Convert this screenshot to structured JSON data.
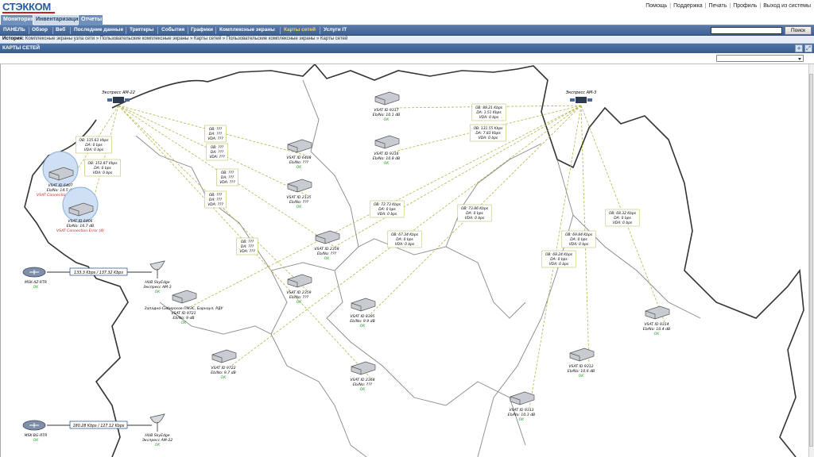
{
  "brand": "СТЭККОМ",
  "top_links": [
    "Помощь",
    "Поддержка",
    "Печать",
    "Профиль",
    "Выход из системы"
  ],
  "main_tabs": [
    "Мониторинг",
    "Инвентаризация",
    "Отчеты"
  ],
  "sub_menu": [
    "ПАНЕЛЬ",
    "Обзор",
    "Веб",
    "Последние данные",
    "Триггеры",
    "События",
    "Графики",
    "Комплексные экраны",
    "Карты сетей",
    "Услуги IT"
  ],
  "search_button": "Поиск",
  "history_label": "История:",
  "history_items": "Комплексные экраны узла сети » Пользовательские комплексные экраны » Карты сетей » Пользовательские комплексные экраны » Карты сетей",
  "page_title": "КАРТЫ СЕТЕЙ",
  "colors": {
    "accent": "#3f6094",
    "ok": "#1a9a1a",
    "error": "#cc2020",
    "link": "#b4b44a"
  },
  "hubs": [
    {
      "id": "hub-am22",
      "label": "Экспресс АМ-22"
    },
    {
      "id": "hub-am3",
      "label": "Экспресс АМ-3"
    }
  ],
  "vsats": [
    {
      "id": "v6407",
      "lines": [
        "VSAT ID 6407",
        "Eb/No: 14.5 dB"
      ],
      "status": "VSAT Connection Error (4)",
      "status_kind": "error"
    },
    {
      "id": "v6406",
      "lines": [
        "VSAT ID 6406",
        "Eb/No: 16.7 dB"
      ],
      "status": "VSAT Connection Error (4)",
      "status_kind": "error"
    },
    {
      "id": "v6408",
      "lines": [
        "VSAT ID 6408",
        "Eb/No: ???"
      ],
      "status": "OK",
      "status_kind": "ok"
    },
    {
      "id": "v9317",
      "lines": [
        "VSAT ID 9317",
        "Eb/No: 10.1 dB"
      ],
      "status": "OK",
      "status_kind": "ok"
    },
    {
      "id": "v9316",
      "lines": [
        "VSAT ID 9316",
        "Eb/No: 10.8 dB"
      ],
      "status": "OK",
      "status_kind": "ok"
    },
    {
      "id": "v2135",
      "lines": [
        "VSAT ID 2135",
        "Eb/No: ???"
      ],
      "status": "OK",
      "status_kind": "ok"
    },
    {
      "id": "v2358",
      "lines": [
        "VSAT ID 2358",
        "Eb/No: ???"
      ],
      "status": "OK",
      "status_kind": "ok"
    },
    {
      "id": "v2359",
      "lines": [
        "VSAT ID 2359",
        "Eb/No: ???"
      ],
      "status": "OK",
      "status_kind": "ok"
    },
    {
      "id": "v9721",
      "lines": [
        "Западно-Сибирское ПМЭС, Барнаул, РДУ",
        "VSAT ID 9721",
        "Eb/No: 9 dB"
      ],
      "status": "OK",
      "status_kind": "ok"
    },
    {
      "id": "v8395",
      "lines": [
        "VSAT ID 8395",
        "Eb/No: 9.9 dB"
      ],
      "status": "OK",
      "status_kind": "ok"
    },
    {
      "id": "v9722",
      "lines": [
        "VSAT ID 9722",
        "Eb/No: 9.7 dB"
      ],
      "status": "OK",
      "status_kind": "ok"
    },
    {
      "id": "v2368",
      "lines": [
        "VSAT ID 2368",
        "Eb/No: ???"
      ],
      "status": "OK",
      "status_kind": "ok"
    },
    {
      "id": "v9313",
      "lines": [
        "VSAT ID 9313",
        "Eb/No: 10.3 dB"
      ],
      "status": "OK",
      "status_kind": "ok"
    },
    {
      "id": "v9312",
      "lines": [
        "VSAT ID 9312",
        "Eb/No: 10.6 dB"
      ],
      "status": "OK",
      "status_kind": "ok"
    },
    {
      "id": "v9314",
      "lines": [
        "VSAT ID 9314",
        "Eb/No: 10.4 dB"
      ],
      "status": "OK",
      "status_kind": "ok"
    }
  ],
  "routers": [
    {
      "id": "r-az",
      "label": "MSK-AZ-RTR",
      "status": "OK"
    },
    {
      "id": "r-bg",
      "label": "MSK-BG-RTR",
      "status": "OK"
    }
  ],
  "hub_dishes": [
    {
      "id": "d-am3",
      "lines": [
        "HUB SkyEdge",
        "Экспресс АМ-3"
      ],
      "status": "OK"
    },
    {
      "id": "d-am22",
      "lines": [
        "HUB SkyEdge",
        "Экспресс АМ-22"
      ],
      "status": "OK"
    }
  ],
  "router_links": [
    "133.3 Kbps / 137.32 Kbps",
    "180.28 Kbps / 127.12 Kbps"
  ],
  "link_labels": [
    [
      "OB: 135.63 Vbps",
      "DA: 0 bps",
      "VDA: 0 bps"
    ],
    [
      "OB: 152.87 Vbps",
      "DA: 0 bps",
      "VDA: 0 bps"
    ],
    [
      "OB: ???",
      "DA: ???",
      "VDA: ???"
    ],
    [
      "OB: ???",
      "DA: ???",
      "VDA: ???"
    ],
    [
      "OB: ???",
      "DA: ???",
      "VDA: ???"
    ],
    [
      "OB: ???",
      "DA: ???",
      "VDA: ???"
    ],
    [
      "OB: ???",
      "DA: ???",
      "VDA: ???"
    ],
    [
      "OB: 88.21 Kbps",
      "DA: 1.51 Kbps",
      "VDA: 0 bps"
    ],
    [
      "OB: 131.55 Kbps",
      "DA: 7.83 Kbps",
      "VDA: 0 bps"
    ],
    [
      "OB: 72.73 Kbps",
      "DA: 0 bps",
      "VDA: 0 bps"
    ],
    [
      "OB: 73.86 Kbps",
      "DA: 0 bps",
      "VDA: 0 bps"
    ],
    [
      "OB: 67.34 Kbps",
      "DA: 0 bps",
      "VDA: 0 bps"
    ],
    [
      "OB: 68.32 Kbps",
      "DA: 0 bps",
      "VDA: 0 bps"
    ],
    [
      "OB: 69.84 Kbps",
      "DA: 0 bps",
      "VDA: 0 bps"
    ],
    [
      "OB: 68.24 Kbps",
      "DA: 0 bps",
      "VDA: 0 bps"
    ]
  ]
}
